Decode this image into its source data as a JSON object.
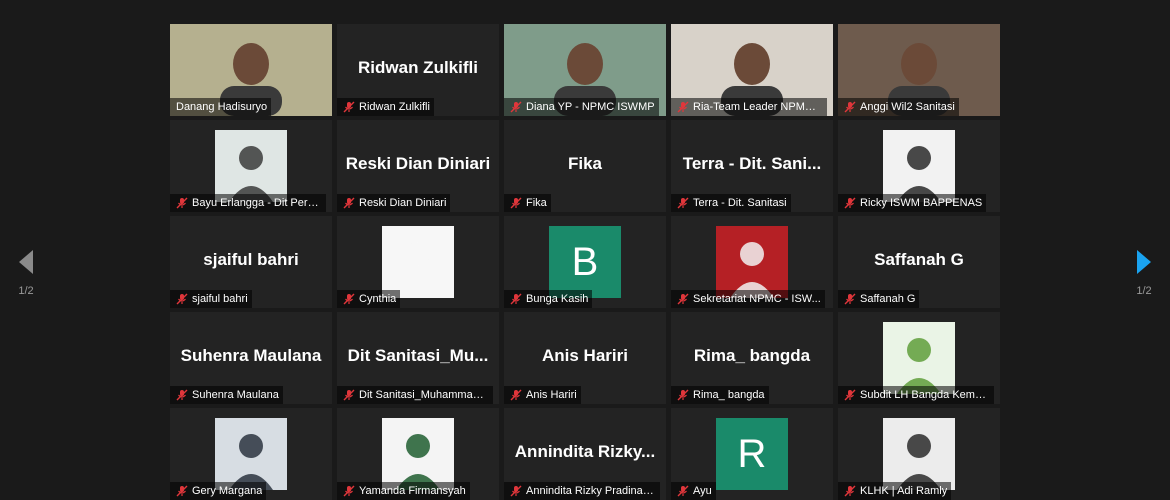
{
  "pagination": {
    "left_label": "1/2",
    "right_label": "1/2"
  },
  "colors": {
    "active_speaker": "#e3e35a",
    "muted": "#e0363b",
    "next_arrow": "#1aa3f0",
    "prev_arrow": "#8a8a8a"
  },
  "participants": [
    {
      "name": "Danang Hadisuryo",
      "kind": "video",
      "muted": false,
      "active": true
    },
    {
      "name": "Ridwan Zulkifli",
      "kind": "name",
      "big": "Ridwan Zulkifli",
      "muted": true
    },
    {
      "name": "Diana YP - NPMC ISWMP",
      "kind": "video",
      "muted": true
    },
    {
      "name": "Ria-Team Leader NPMC I...",
      "kind": "video",
      "muted": true
    },
    {
      "name": "Anggi Wil2 Sanitasi",
      "kind": "video",
      "muted": true
    },
    {
      "name": "Bayu Erlangga - Dit Perki...",
      "kind": "photo",
      "muted": true
    },
    {
      "name": "Reski Dian Diniari",
      "kind": "name",
      "big": "Reski Dian Diniari",
      "muted": true
    },
    {
      "name": "Fika",
      "kind": "name",
      "big": "Fika",
      "muted": true
    },
    {
      "name": "Terra - Dit. Sanitasi",
      "kind": "name",
      "big": "Terra - Dit. Sani...",
      "muted": true
    },
    {
      "name": "Ricky ISWM BAPPENAS",
      "kind": "photo",
      "muted": true
    },
    {
      "name": "sjaiful bahri",
      "kind": "name",
      "big": "sjaiful bahri",
      "muted": true
    },
    {
      "name": "Cynthia",
      "kind": "photo",
      "muted": true
    },
    {
      "name": "Bunga Kasih",
      "kind": "letter",
      "letter": "B",
      "muted": true
    },
    {
      "name": "Sekretariat NPMC - ISW...",
      "kind": "photo",
      "muted": true
    },
    {
      "name": "Saffanah G",
      "kind": "name",
      "big": "Saffanah G",
      "muted": true
    },
    {
      "name": "Suhenra Maulana",
      "kind": "name",
      "big": "Suhenra Maulana",
      "muted": true
    },
    {
      "name": "Dit Sanitasi_Muhammad I...",
      "kind": "name",
      "big": "Dit Sanitasi_Mu...",
      "muted": true
    },
    {
      "name": "Anis Hariri",
      "kind": "name",
      "big": "Anis Hariri",
      "muted": true
    },
    {
      "name": "Rima_ bangda",
      "kind": "name",
      "big": "Rima_ bangda",
      "muted": true
    },
    {
      "name": "Subdit LH Bangda Kemen...",
      "kind": "photo",
      "muted": true
    },
    {
      "name": "Gery Margana",
      "kind": "photo",
      "muted": true
    },
    {
      "name": "Yamanda Firmansyah",
      "kind": "photo",
      "muted": true
    },
    {
      "name": "Annindita Rizky Pradina S...",
      "kind": "name",
      "big": "Annindita Rizky...",
      "muted": true
    },
    {
      "name": "Ayu",
      "kind": "letter",
      "letter": "R",
      "muted": true
    },
    {
      "name": "KLHK | Adi Ramly",
      "kind": "photo",
      "muted": true
    }
  ]
}
